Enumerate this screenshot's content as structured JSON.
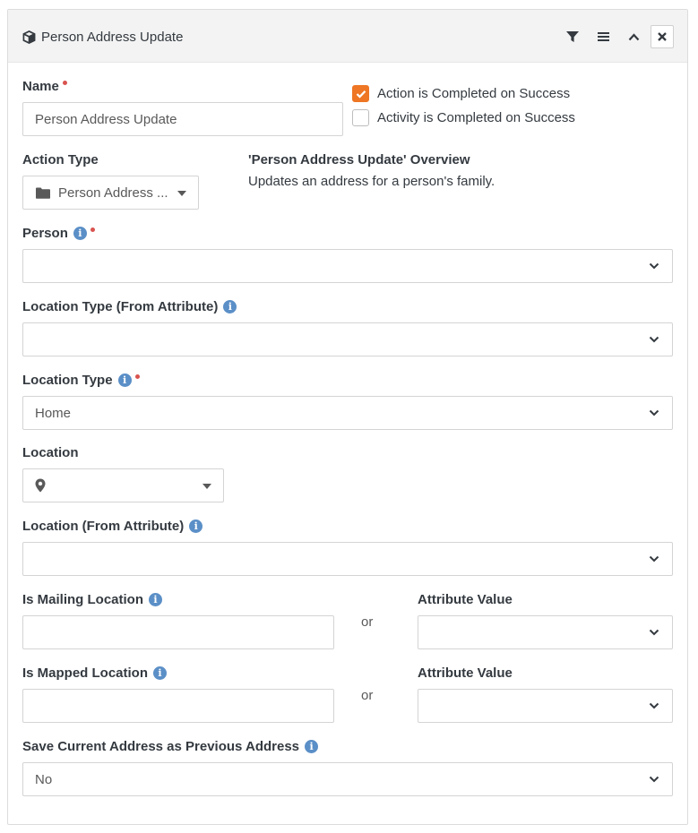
{
  "header": {
    "title": "Person Address Update"
  },
  "name_field": {
    "label": "Name",
    "value": "Person Address Update"
  },
  "checkboxes": [
    {
      "label": "Action is Completed on Success",
      "checked": true
    },
    {
      "label": "Activity is Completed on Success",
      "checked": false
    }
  ],
  "action_type": {
    "label": "Action Type",
    "value": "Person Address ..."
  },
  "overview": {
    "title": "'Person Address Update' Overview",
    "text": "Updates an address for a person's family."
  },
  "person": {
    "label": "Person",
    "value": ""
  },
  "location_type_attr": {
    "label": "Location Type (From Attribute)",
    "value": ""
  },
  "location_type": {
    "label": "Location Type",
    "value": "Home"
  },
  "location": {
    "label": "Location",
    "value": ""
  },
  "location_attr": {
    "label": "Location (From Attribute)",
    "value": ""
  },
  "mailing": {
    "label": "Is Mailing Location",
    "value": "",
    "or": "or",
    "attr_label": "Attribute Value",
    "attr_value": ""
  },
  "mapped": {
    "label": "Is Mapped Location",
    "value": "",
    "or": "or",
    "attr_label": "Attribute Value",
    "attr_value": ""
  },
  "save_previous": {
    "label": "Save Current Address as Previous Address",
    "value": "No"
  },
  "colors": {
    "accent": "#ee7624",
    "required": "#d9534f",
    "info": "#5b8fc7"
  }
}
